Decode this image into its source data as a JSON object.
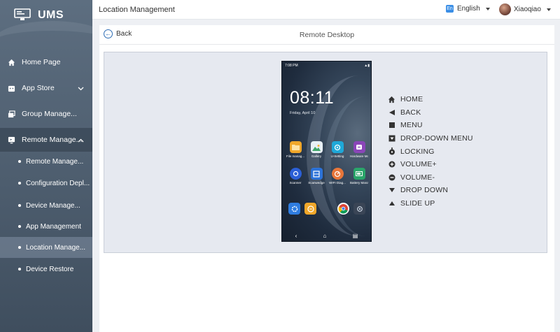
{
  "sidebar": {
    "logo": "UMS",
    "items": [
      {
        "label": "Home Page",
        "icon": "home-icon"
      },
      {
        "label": "App Store",
        "icon": "store-icon"
      },
      {
        "label": "Group Manage...",
        "icon": "group-icon"
      },
      {
        "label": "Remote Manage...",
        "icon": "remote-icon"
      }
    ],
    "subitems": [
      {
        "label": "Remote Manage..."
      },
      {
        "label": "Configuration Depl..."
      },
      {
        "label": "Device  Manage..."
      },
      {
        "label": "App Management"
      },
      {
        "label": "Location Manage..."
      },
      {
        "label": "Device Restore"
      }
    ]
  },
  "header": {
    "title": "Location Management",
    "language": "English",
    "language_badge": "En",
    "username": "Xiaoqiao"
  },
  "panel": {
    "back_label": "Back",
    "title": "Remote Desktop"
  },
  "phone": {
    "status_left": "7:08 PM",
    "time": "08:11",
    "date": "Friday, April 10",
    "apps": [
      {
        "label": "File manag...",
        "color": "#f0a72a"
      },
      {
        "label": "Gallery",
        "color": "#e8f0f6"
      },
      {
        "label": "U-Setting",
        "color": "#1fa8d8"
      },
      {
        "label": "Hardware Mo...",
        "color": "#8a46b8"
      },
      {
        "label": "Scanner",
        "color": "#2b5fd6"
      },
      {
        "label": "Scanwedge",
        "color": "#2c72d8"
      },
      {
        "label": "WIFI Diag...",
        "color": "#e8763a"
      },
      {
        "label": "Battery Mana...",
        "color": "#2aa56a"
      }
    ]
  },
  "controls": [
    {
      "label": "HOME",
      "icon": "home-icon"
    },
    {
      "label": "BACK",
      "icon": "back-triangle-icon"
    },
    {
      "label": "MENU",
      "icon": "menu-square-icon"
    },
    {
      "label": "DROP-DOWN MENU",
      "icon": "dropdown-menu-icon"
    },
    {
      "label": "LOCKING",
      "icon": "lock-icon"
    },
    {
      "label": "VOLUME+",
      "icon": "volume-up-icon"
    },
    {
      "label": "VOLUME-",
      "icon": "volume-down-icon"
    },
    {
      "label": "DROP DOWN",
      "icon": "drop-down-icon"
    },
    {
      "label": "SLIDE UP",
      "icon": "slide-up-icon"
    }
  ]
}
